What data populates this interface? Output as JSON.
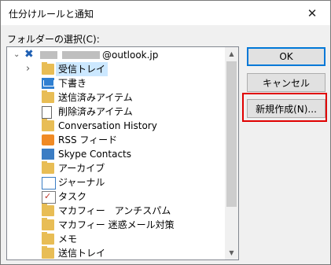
{
  "dialog": {
    "title": "仕分けルールと通知",
    "close": "✕"
  },
  "folder_label": "フォルダーの選択(C):",
  "account": {
    "email_suffix": "@outlook.jp",
    "expander": "⌄"
  },
  "folders": [
    {
      "label": "受信トレイ",
      "icon": "inbox-icon",
      "selected": true,
      "expander": "›"
    },
    {
      "label": "下書き",
      "icon": "drafts-icon"
    },
    {
      "label": "送信済みアイテム",
      "icon": "sent-icon"
    },
    {
      "label": "削除済みアイテム",
      "icon": "trash-icon"
    },
    {
      "label": "Conversation History",
      "icon": "folder-icon"
    },
    {
      "label": "RSS フィード",
      "icon": "rss-icon"
    },
    {
      "label": "Skype Contacts",
      "icon": "contacts-icon"
    },
    {
      "label": "アーカイブ",
      "icon": "folder-icon"
    },
    {
      "label": "ジャーナル",
      "icon": "journal-icon"
    },
    {
      "label": "タスク",
      "icon": "task-icon"
    },
    {
      "label": "マカフィー　アンチスパム",
      "icon": "folder-icon"
    },
    {
      "label": "マカフィー 迷惑メール対策",
      "icon": "folder-icon"
    },
    {
      "label": "メモ",
      "icon": "folder-icon"
    },
    {
      "label": "送信トレイ",
      "icon": "outbox-icon"
    }
  ],
  "buttons": {
    "ok": "OK",
    "cancel": "キャンセル",
    "new": "新規作成(N)..."
  },
  "colors": {
    "highlight": "#e00000",
    "selection": "#cce8ff",
    "default_border": "#0078d7"
  }
}
